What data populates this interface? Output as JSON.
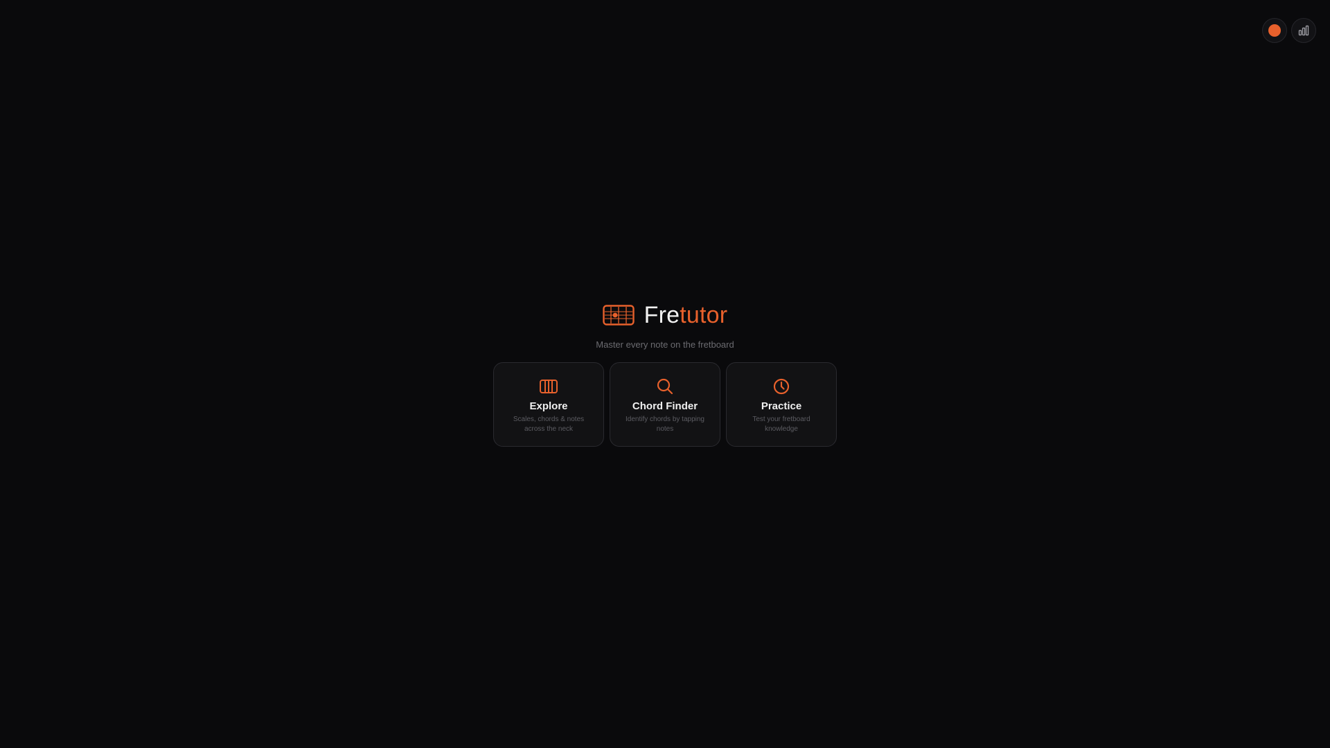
{
  "theme": {
    "accent": "#e8612c",
    "background": "#0a0a0c"
  },
  "top_controls": {
    "accent_toggle": {
      "icon": "accent-color-dot-icon"
    },
    "stats_button": {
      "icon": "bar-chart-icon"
    }
  },
  "brand": {
    "logo_icon": "fretboard-icon",
    "title_plain": "Fre",
    "title_accent": "tutor"
  },
  "tagline": "Master every note on the fretboard",
  "cards": [
    {
      "icon": "fretboard-grid-icon",
      "title": "Explore",
      "description": "Scales, chords & notes across the neck"
    },
    {
      "icon": "search-icon",
      "title": "Chord Finder",
      "description": "Identify chords by tapping notes"
    },
    {
      "icon": "clock-icon",
      "title": "Practice",
      "description": "Test your fretboard knowledge"
    }
  ]
}
